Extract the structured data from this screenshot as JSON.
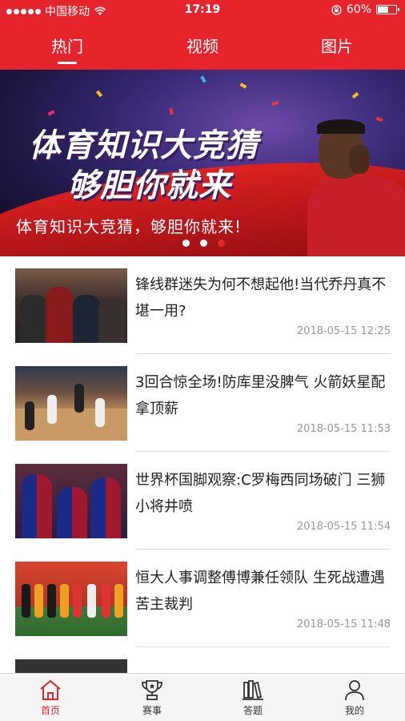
{
  "status_bar": {
    "carrier": "中国移动",
    "time": "17:19",
    "battery": "60%",
    "battery_level": 0.6
  },
  "top_tabs": [
    {
      "label": "热门",
      "active": true
    },
    {
      "label": "视频",
      "active": false
    },
    {
      "label": "图片",
      "active": false
    }
  ],
  "banner": {
    "title_line1": "体育知识大竞猜",
    "title_line2": "够胆你就来",
    "caption": "体育知识大竞猜，够胆你就来!",
    "dots_count": 3,
    "active_dot": 2
  },
  "news": [
    {
      "title": "锋线群迷失为何不想起他!当代乔丹真不堪一用?",
      "time": "2018-05-15 12:25"
    },
    {
      "title": "3回合惊全场!防库里没脾气 火箭妖星配拿顶薪",
      "time": "2018-05-15 11:53"
    },
    {
      "title": "世界杯国脚观察:C罗梅西同场破门 三狮小将井喷",
      "time": "2018-05-15 11:54"
    },
    {
      "title": "恒大人事调整傅博兼任领队 生死战遭遇苦主裁判",
      "time": "2018-05-15 11:48"
    }
  ],
  "bottom_tabs": [
    {
      "label": "首页",
      "icon": "home-icon",
      "active": true
    },
    {
      "label": "赛事",
      "icon": "trophy-icon",
      "active": false
    },
    {
      "label": "答题",
      "icon": "books-icon",
      "active": false
    },
    {
      "label": "我的",
      "icon": "user-icon",
      "active": false
    }
  ],
  "colors": {
    "accent": "#e5252b",
    "tabbar_bg": "#f5f5f5",
    "time_text": "#999999"
  }
}
